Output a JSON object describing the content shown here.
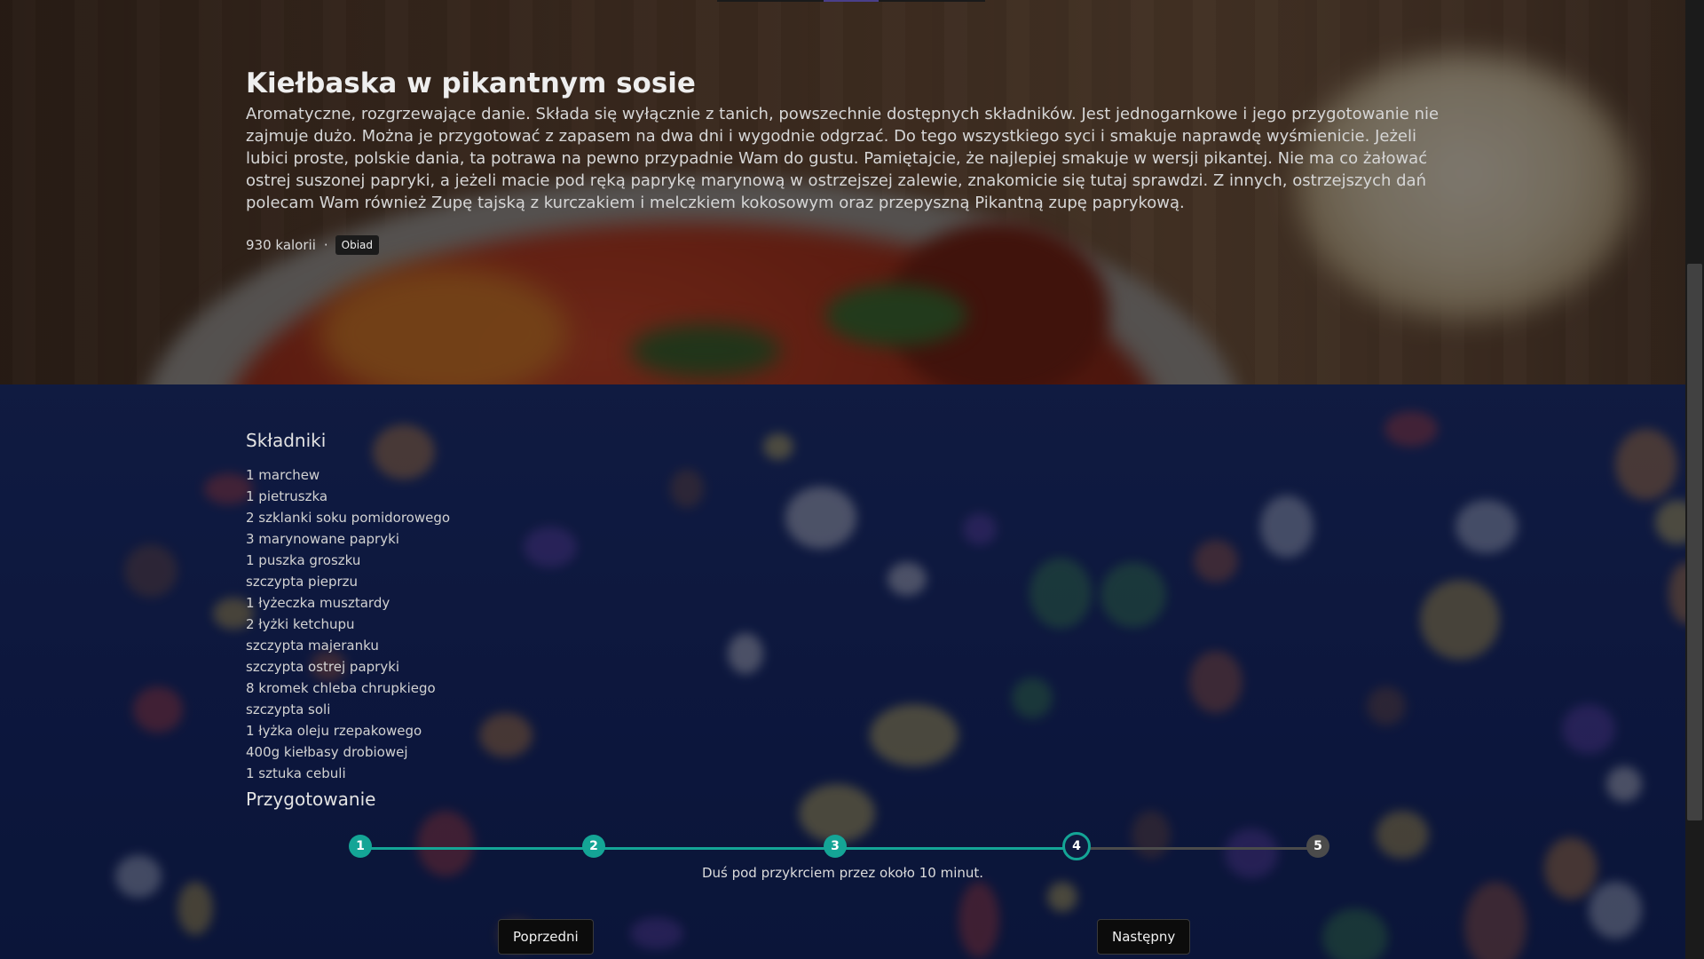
{
  "recipe": {
    "title": "Kiełbaska w pikantnym sosie",
    "description": "Aromatyczne, rozgrzewające danie. Składa się wyłącznie z tanich, powszechnie dostępnych składników. Jest jednogarnkowe i jego przygotowanie nie zajmuje dużo. Można je przygotować z zapasem na dwa dni i wygodnie odgrzać. Do tego wszystkiego syci i smakuje naprawdę wyśmienicie. Jeżeli lubici proste, polskie dania, ta potrawa na pewno przypadnie Wam do gustu. Pamiętajcie, że najlepiej smakuje w wersji pikantej. Nie ma co żałować ostrej suszonej papryki, a jeżeli macie pod ręką paprykę marynową w ostrzejszej zalewie, znakomicie się tutaj sprawdzi. Z innych, ostrzejszych dań polecam Wam również Zupę tajską z kurczakiem i melczkiem kokosowym oraz przepyszną Pikantną zupę paprykową.",
    "calories": "930 kalorii",
    "separator": "·",
    "category": "Obiad"
  },
  "ingredients": {
    "title": "Składniki",
    "items": [
      "1 marchew",
      "1 pietruszka",
      "2 szklanki soku pomidorowego",
      "3 marynowane papryki",
      "1 puszka groszku",
      "szczypta pieprzu",
      "1 łyżeczka musztardy",
      "2 łyżki ketchupu",
      "szczypta majeranku",
      "szczypta ostrej papryki",
      "8 kromek chleba chrupkiego",
      "szczypta soli",
      "1 łyżka oleju rzepakowego",
      "400g kiełbasy drobiowej",
      "1 sztuka cebuli"
    ]
  },
  "preparation": {
    "title": "Przygotowanie",
    "steps": [
      "1",
      "2",
      "3",
      "4",
      "5"
    ],
    "current_step": 4,
    "total_steps": 5,
    "current_text": "Duś pod przykrciem przez około 10 minut.",
    "prev_label": "Poprzedni",
    "next_label": "Następny"
  },
  "colors": {
    "accent": "#14a596",
    "inactive": "#4b4b4b",
    "hero_overlay": "#000000",
    "main_bg": "#0f1a45"
  }
}
